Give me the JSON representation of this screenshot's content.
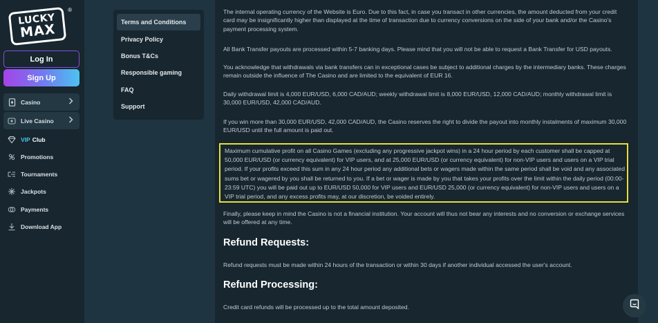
{
  "brand": {
    "line1": "LUCKY",
    "line2": "MAX",
    "reg": "®"
  },
  "auth": {
    "login": "Log In",
    "signup": "Sign Up"
  },
  "nav": {
    "casino": "Casino",
    "live_casino": "Live Casino",
    "vip_prefix": "VIP",
    "vip_suffix": "Club",
    "promotions": "Promotions",
    "tournaments": "Tournaments",
    "jackpots": "Jackpots",
    "payments": "Payments",
    "download": "Download App"
  },
  "menu": {
    "items": [
      "Terms and Conditions",
      "Privacy Policy",
      "Bonus T&Cs",
      "Responsible gaming",
      "FAQ",
      "Support"
    ]
  },
  "content": {
    "p1": "The internal operating currency of the Website is Euro. Due to this fact, in case you transact in other currencies, the amount deducted from your credit card may be insignificantly higher than displayed at the time of transaction due to currency conversions on the side of your bank and/or the Casino's payment processing system.",
    "p2": "All Bank Transfer payouts are processed within 5-7 banking days. Please mind that you will not be able to request a Bank Transfer for USD payouts.",
    "p3": "You acknowledge that withdrawals via bank transfers can in exceptional cases be subject to additional charges by the intermediary banks. These charges remain outside the influence of The Casino and are limited to the equivalent of EUR 16.",
    "p4": "Daily withdrawal limit is 4,000 EUR/USD, 6,000 CAD/AUD; weekly withdrawal limit is 8,000 EUR/USD, 12,000 CAD/AUD; monthly withdrawal limit is 30,000 EUR/USD, 42,000 CAD/AUD.",
    "p5": "If you win more than 30,000 EUR/USD, 42,000 CAD/AUD, the Casino reserves the right to divide the payout into monthly instalments of maximum 30,000 EUR/USD until the full amount is paid out.",
    "highlight": "Maximum cumulative profit on all Casino Games (excluding any progressive jackpot wins) in a 24 hour period by each customer shall be capped at 50,000 EUR/USD (or currency equivalent) for VIP users, and at 25,000 EUR/USD (or currency equivalent) for non-VIP users and users on a VIP trial period. If your profits exceed this sum in any 24 hour period any additional bets or wagers made within the same period shall be void and any associated sums bet or wagered by you shall be returned to you. If a bet or wager is made by you that takes your profits over the limit within the daily period (00:00-23:59 UTC) you will be paid out up to EUR/USD 50,000 for VIP users and EUR/USD 25,000 (or currency equivalent) for non-VIP users and users on a VIP trial period, and any excess profits may, at our discretion, be voided entirely.",
    "p6": "Finally, please keep in mind the Casino is not a financial institution. Your account will thus not bear any interests and no conversion or exchange services will be offered at any time.",
    "h_refund_requests": "Refund Requests:",
    "p7": "Refund requests must be made within 24 hours of the transaction or within 30 days if another individual accessed the user's account.",
    "h_refund_processing": "Refund Processing:",
    "p8": "Credit card refunds will be processed up to the total amount deposited."
  },
  "colors": {
    "highlight_border": "#e8df3a",
    "vip_accent": "#4cc3ee",
    "signup_gradient_start": "#a543e8",
    "signup_gradient_end": "#4dc3f0"
  },
  "icons": [
    "casino-card-icon",
    "live-casino-icon",
    "diamond-icon",
    "promotions-icon",
    "tournaments-icon",
    "jackpots-icon",
    "payments-icon",
    "download-icon",
    "chat-icon",
    "chevron-right-icon"
  ]
}
